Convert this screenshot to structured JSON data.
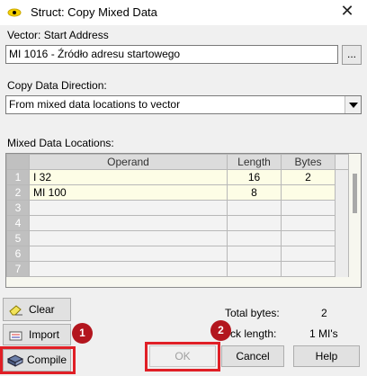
{
  "window": {
    "title": "Struct: Copy Mixed Data",
    "close_glyph": "✕"
  },
  "vector": {
    "label": "Vector: Start Address",
    "value": "MI 1016  - Źródło adresu startowego",
    "browse_label": "..."
  },
  "direction": {
    "label": "Copy Data Direction:",
    "selected": "From mixed data locations to vector"
  },
  "mixed": {
    "label": "Mixed Data Locations:",
    "columns": [
      "Operand",
      "Length",
      "Bytes"
    ],
    "rows": [
      {
        "num": "1",
        "operand": "I 32",
        "length": "16",
        "bytes": "2"
      },
      {
        "num": "2",
        "operand": "MI 100",
        "length": "8",
        "bytes": ""
      },
      {
        "num": "3",
        "operand": "",
        "length": "",
        "bytes": ""
      },
      {
        "num": "4",
        "operand": "",
        "length": "",
        "bytes": ""
      },
      {
        "num": "5",
        "operand": "",
        "length": "",
        "bytes": ""
      },
      {
        "num": "6",
        "operand": "",
        "length": "",
        "bytes": ""
      },
      {
        "num": "7",
        "operand": "",
        "length": "",
        "bytes": ""
      }
    ]
  },
  "buttons": {
    "clear": "Clear",
    "import": "Import",
    "compile": "Compile",
    "ok": "OK",
    "cancel": "Cancel",
    "help": "Help"
  },
  "summary": {
    "total_bytes_label": "Total bytes:",
    "total_bytes_value": "2",
    "block_length_label": "ck length:",
    "block_length_value": "1 MI's"
  },
  "annotations": {
    "badge_1": "1",
    "badge_2": "2",
    "highlight_color": "#e01f26",
    "badge_color": "#b3161e"
  }
}
